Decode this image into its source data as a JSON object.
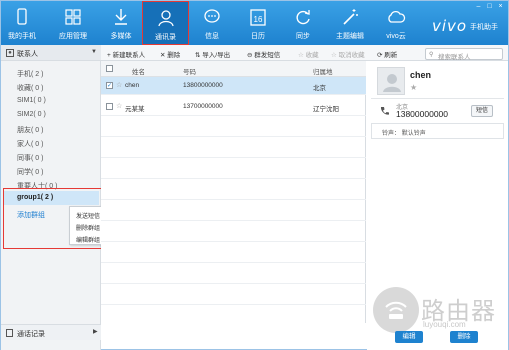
{
  "app": {
    "brand": "vivo",
    "brand_sub": "手机助手"
  },
  "window_controls": [
    "–",
    "□",
    "×"
  ],
  "nav": [
    {
      "label": "我的手机",
      "icon": "phone-icon"
    },
    {
      "label": "应用管理",
      "icon": "apps-icon"
    },
    {
      "label": "多媒体",
      "icon": "download-icon"
    },
    {
      "label": "通讯录",
      "icon": "contact-icon",
      "active": true
    },
    {
      "label": "信息",
      "icon": "message-icon"
    },
    {
      "label": "日历",
      "icon": "calendar-icon",
      "day": "16"
    },
    {
      "label": "同步",
      "icon": "sync-icon"
    },
    {
      "label": "主题编辑",
      "icon": "magic-wand-icon"
    },
    {
      "label": "vivo云",
      "icon": "cloud-icon"
    }
  ],
  "sidebar": {
    "header": "联系人",
    "items": [
      "手机( 2 )",
      "收藏( 0 )",
      "SIM1( 0 )",
      "SIM2( 0 )",
      "朋友( 0 )",
      "家人( 0 )",
      "同事( 0 )",
      "同学( 0 )",
      "重要人士( 0 )"
    ],
    "selected": "group1( 2 )",
    "add_group": "添加群组",
    "context_menu": [
      "发送短信",
      "删除群组",
      "编辑群组"
    ],
    "footer": "通话记录"
  },
  "toolbar": {
    "new_contact": "新建联系人",
    "delete": "删除",
    "import_export": "导入/导出",
    "send_sms": "群发短信",
    "favorite": "收藏",
    "unfavorite": "取消收藏",
    "refresh": "刷新",
    "search_placeholder": "搜索联系人"
  },
  "table": {
    "headers": {
      "name": "姓名",
      "number": "号码",
      "location": "归属地"
    },
    "rows": [
      {
        "name": "chen",
        "number": "13800000000",
        "location": "北京",
        "checked": true
      },
      {
        "name": "元某某",
        "number": "13700000000",
        "location": "辽宁沈阳",
        "checked": false
      }
    ]
  },
  "detail": {
    "name": "chen",
    "location": "北京",
    "phone": "13800000000",
    "sms_button": "短信",
    "ringtone_label": "铃声：",
    "ringtone_value": "默认铃声",
    "edit_button": "编辑",
    "delete_button": "删除"
  },
  "watermark": {
    "title": "路由器",
    "url": "luyouqi.com"
  },
  "colors": {
    "accent": "#1e82cf",
    "highlight": "#cfe6f8",
    "red_outline": "#e53935"
  }
}
